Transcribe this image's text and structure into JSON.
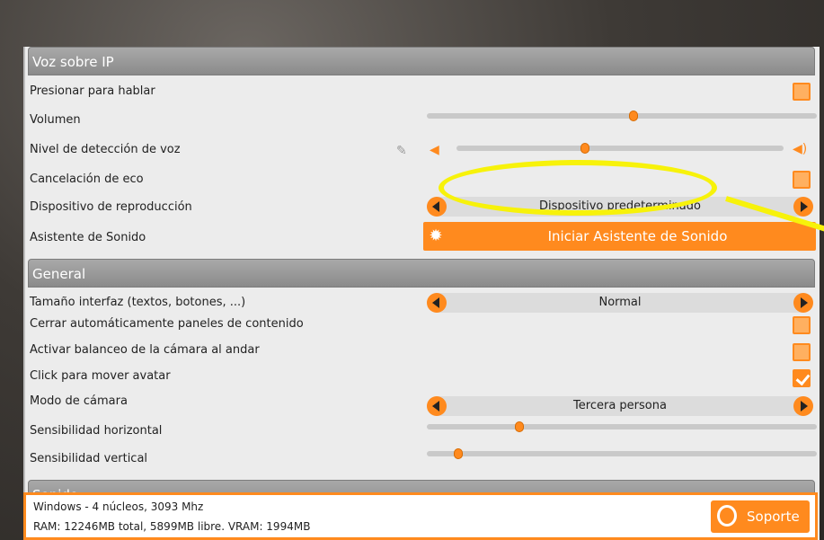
{
  "sections": {
    "voip": "Voz sobre IP",
    "general": "General",
    "sound": "Sonido"
  },
  "voip": {
    "push_to_talk": {
      "label": "Presionar para hablar",
      "checked": false
    },
    "volume": {
      "label": "Volumen",
      "level": 0.53
    },
    "voice_detection": {
      "label": "Nivel de detección de voz",
      "level": 0.39
    },
    "echo_cancel": {
      "label": "Cancelación de eco",
      "checked": false
    },
    "playback_device": {
      "label": "Dispositivo de reproducción",
      "value": "Dispositivo predeterminado"
    },
    "sound_wizard": {
      "label": "Asistente de Sonido",
      "button": "Iniciar Asistente de Sonido"
    }
  },
  "general": {
    "ui_size": {
      "label": "Tamaño interfaz (textos, botones, ...)",
      "value": "Normal"
    },
    "auto_close": {
      "label": "Cerrar automáticamente paneles de contenido",
      "checked": false
    },
    "camera_sway": {
      "label": "Activar balanceo de la cámara al andar",
      "checked": false
    },
    "click_move": {
      "label": "Click para mover avatar",
      "checked": true
    },
    "camera_mode": {
      "label": "Modo de cámara",
      "value": "Tercera persona"
    },
    "h_sens": {
      "label": "Sensibilidad horizontal",
      "level": 0.23
    },
    "v_sens": {
      "label": "Sensibilidad vertical",
      "level": 0.07
    }
  },
  "footer": {
    "line1": "Windows - 4 núcleos, 3093 Mhz",
    "line2": "RAM: 12246MB total, 5899MB libre. VRAM: 1994MB",
    "support": "Soporte"
  },
  "icons": {
    "mic": "microphone-icon",
    "vol_low": "speaker-low-icon",
    "vol_high": "speaker-high-icon",
    "gear": "gear-icon",
    "support": "headset-icon"
  },
  "colors": {
    "accent": "#ff8a1e",
    "highlight": "#f7f20a"
  }
}
